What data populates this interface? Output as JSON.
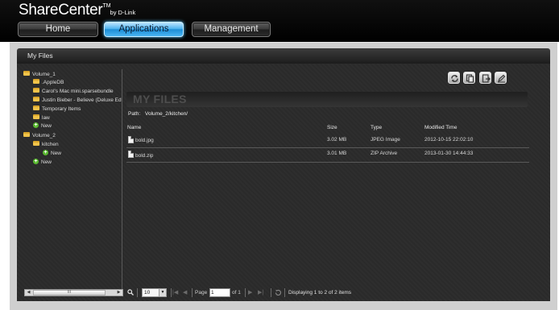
{
  "app": {
    "brand": "ShareCenter",
    "brand_tm": "TM",
    "brand_by": "by D-Link"
  },
  "nav": {
    "home": "Home",
    "applications": "Applications",
    "management": "Management"
  },
  "window": {
    "title": "My Files"
  },
  "tree": {
    "nodes": [
      {
        "label": "Volume_1",
        "icon": "folder-icon"
      },
      {
        "label": ".AppleDB",
        "icon": "folder-icon"
      },
      {
        "label": "Carol's Mac mini.sparsebundle",
        "icon": "folder-icon"
      },
      {
        "label": "Justin Bieber - Believe (Deluxe Ed",
        "icon": "folder-icon"
      },
      {
        "label": "Temporary Items",
        "icon": "folder-icon"
      },
      {
        "label": "law",
        "icon": "folder-icon"
      },
      {
        "label": "New",
        "icon": "add-icon"
      },
      {
        "label": "Volume_2",
        "icon": "folder-icon"
      },
      {
        "label": "kitchen",
        "icon": "folder-icon"
      },
      {
        "label": "New",
        "icon": "add-icon"
      },
      {
        "label": "New",
        "icon": "add-icon"
      }
    ],
    "scroll_thumb": "III"
  },
  "toolbar": {
    "icons": [
      "refresh-icon",
      "copy-icon",
      "move-icon",
      "rename-icon"
    ]
  },
  "main": {
    "section_title": "MY FILES",
    "path_label": "Path:",
    "path_value": "Volume_2/kitchen/",
    "columns": {
      "name": "Name",
      "size": "Size",
      "type": "Type",
      "modified": "Modified Time"
    },
    "files": [
      {
        "name": "bold.jpg",
        "size": "3.02 MB",
        "type": "JPEG Image",
        "modified": "2012-10-15 22:02:10"
      },
      {
        "name": "bold.zip",
        "size": "3.01 MB",
        "type": "ZIP Archive",
        "modified": "2013-01-30 14:44:33"
      }
    ]
  },
  "pager": {
    "page_size": "10",
    "page_label": "Page",
    "page_value": "1",
    "of_label": "of 1",
    "status": "Displaying 1 to 2 of 2 items"
  },
  "colors": {
    "header_bg": "#000000",
    "active_tab": "#2a9be0",
    "panel_bg": "#2b2b2b",
    "folder": "#f0c34a",
    "add": "#59b82f"
  }
}
